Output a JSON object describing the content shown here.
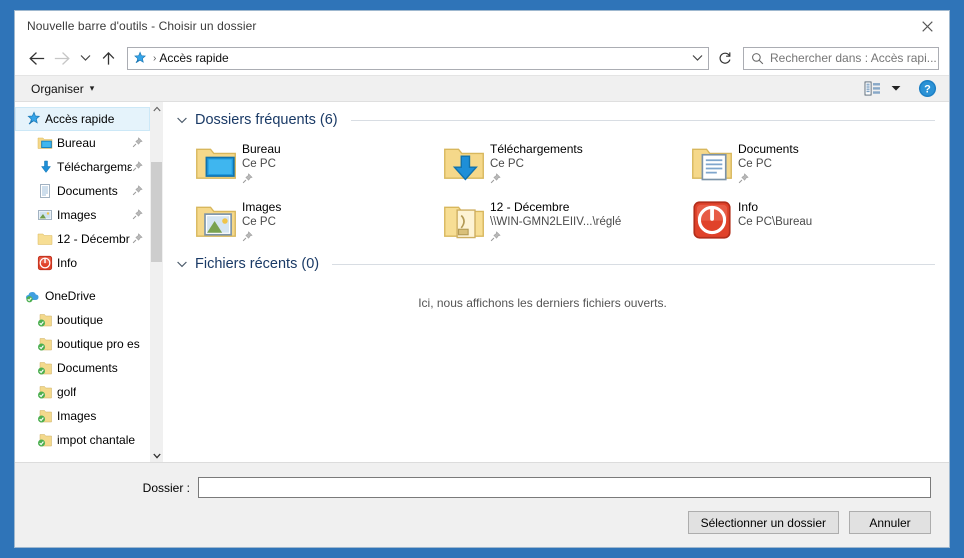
{
  "window": {
    "title": "Nouvelle barre d'outils - Choisir un dossier",
    "close_label": "Fermer"
  },
  "nav": {
    "back_label": "Précédent",
    "forward_label": "Suivant",
    "recent_label": "Emplacements récents",
    "up_label": "Remonter d'un niveau",
    "breadcrumb": "Accès rapide",
    "breadcrumb_separator": "›",
    "refresh_label": "Actualiser",
    "address_dropdown_label": "Précédents"
  },
  "search": {
    "placeholder": "Rechercher dans : Accès rapi...",
    "icon": "search-icon"
  },
  "commandbar": {
    "organiser_label": "Organiser",
    "organiser_caret": "▾",
    "view_label": "Modifier l'affichage",
    "view_caret": "▾",
    "help_label": "?"
  },
  "sidebar": {
    "items": [
      {
        "label": "Accès rapide",
        "icon": "pin-star-icon",
        "level": 0,
        "selected": true,
        "pinned": false
      },
      {
        "label": "Bureau",
        "icon": "desktop-folder-icon",
        "level": 1,
        "selected": false,
        "pinned": true
      },
      {
        "label": "Téléchargemε",
        "icon": "downloads-icon",
        "level": 1,
        "selected": false,
        "pinned": true
      },
      {
        "label": "Documents",
        "icon": "documents-icon",
        "level": 1,
        "selected": false,
        "pinned": true
      },
      {
        "label": "Images",
        "icon": "pictures-icon",
        "level": 1,
        "selected": false,
        "pinned": true
      },
      {
        "label": "12 - Décembr",
        "icon": "folder-icon",
        "level": 1,
        "selected": false,
        "pinned": true
      },
      {
        "label": "Info",
        "icon": "info-red-icon",
        "level": 1,
        "selected": false,
        "pinned": false
      },
      {
        "label": "",
        "icon": "spacer",
        "level": 1,
        "selected": false,
        "pinned": false
      },
      {
        "label": "OneDrive",
        "icon": "onedrive-icon",
        "level": 0,
        "selected": false,
        "pinned": false
      },
      {
        "label": "boutique",
        "icon": "onedrive-folder-icon",
        "level": 1,
        "selected": false,
        "pinned": false
      },
      {
        "label": "boutique pro es",
        "icon": "onedrive-folder-icon",
        "level": 1,
        "selected": false,
        "pinned": false
      },
      {
        "label": "Documents",
        "icon": "onedrive-folder-icon",
        "level": 1,
        "selected": false,
        "pinned": false
      },
      {
        "label": "golf",
        "icon": "onedrive-folder-icon",
        "level": 1,
        "selected": false,
        "pinned": false
      },
      {
        "label": "Images",
        "icon": "onedrive-folder-icon",
        "level": 1,
        "selected": false,
        "pinned": false
      },
      {
        "label": "impot chantale ",
        "icon": "onedrive-folder-icon",
        "level": 1,
        "selected": false,
        "pinned": false
      }
    ]
  },
  "content": {
    "frequent": {
      "title": "Dossiers fréquents (6)",
      "chevron": "chevron-down-icon",
      "items": [
        {
          "name": "Bureau",
          "sub": "Ce PC",
          "icon": "desktop-folder-icon",
          "pinned": true
        },
        {
          "name": "Téléchargements",
          "sub": "Ce PC",
          "icon": "downloads-folder-icon",
          "pinned": true
        },
        {
          "name": "Documents",
          "sub": "Ce PC",
          "icon": "documents-folder-icon",
          "pinned": true
        },
        {
          "name": "Images",
          "sub": "Ce PC",
          "icon": "pictures-folder-icon",
          "pinned": true
        },
        {
          "name": "12 - Décembre",
          "sub": "\\\\WIN-GMN2LEIIV...\\réglé",
          "icon": "network-folder-icon",
          "pinned": true
        },
        {
          "name": "Info",
          "sub": "Ce PC\\Bureau",
          "icon": "info-red-icon",
          "pinned": false
        }
      ]
    },
    "recent": {
      "title": "Fichiers récents (0)",
      "chevron": "chevron-down-icon",
      "empty_message": "Ici, nous affichons les derniers fichiers ouverts."
    }
  },
  "footer": {
    "folder_label": "Dossier :",
    "folder_value": "",
    "folder_placeholder": "",
    "select_button": "Sélectionner un dossier",
    "cancel_button": "Annuler"
  },
  "colors": {
    "accent": "#0078d7",
    "desktop": "#2f74b8",
    "group_title": "#1a3a66",
    "selection": "#e5f3fb",
    "chrome": "#f0f0f0"
  }
}
